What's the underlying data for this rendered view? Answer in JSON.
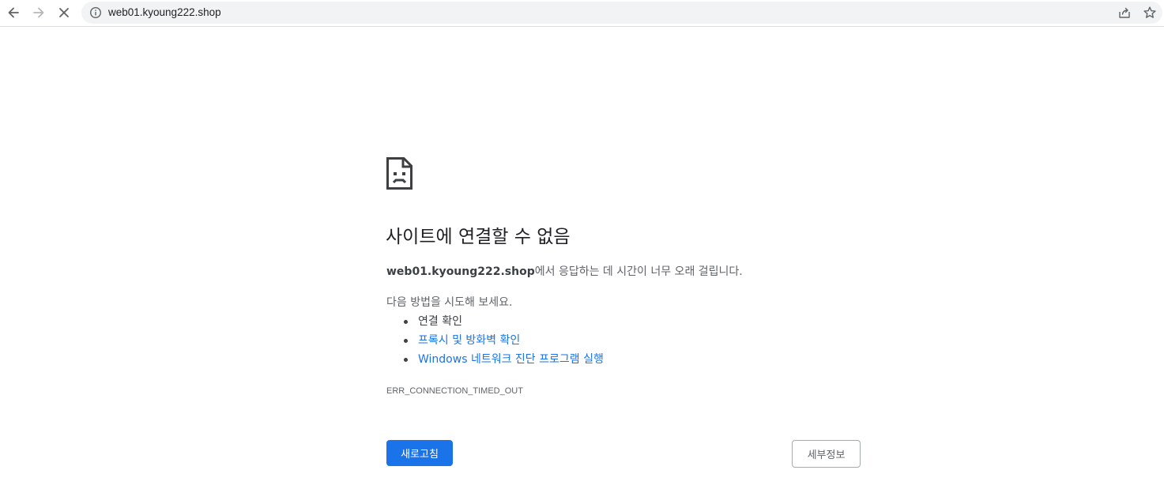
{
  "browser": {
    "url": "web01.kyoung222.shop",
    "icons": {
      "back": "arrow-left-icon",
      "forward": "arrow-right-icon",
      "stop": "close-icon",
      "site_info": "info-icon",
      "share": "share-icon",
      "bookmark": "star-icon"
    }
  },
  "error_page": {
    "icon": "sad-page-icon",
    "heading": "사이트에 연결할 수 없음",
    "summary_host": "web01.kyoung222.shop",
    "summary_text": "에서 응답하는 데 시간이 너무 오래 걸립니다.",
    "suggestions_intro": "다음 방법을 시도해 보세요.",
    "suggestions": [
      {
        "label": "연결 확인",
        "link": false
      },
      {
        "label": "프록시 및 방화벽 확인",
        "link": true
      },
      {
        "label": "Windows 네트워크 진단 프로그램 실행",
        "link": true
      }
    ],
    "error_code": "ERR_CONNECTION_TIMED_OUT",
    "reload_label": "새로고침",
    "details_label": "세부정보"
  },
  "colors": {
    "accent": "#1a73e8",
    "text_primary": "#202124",
    "text_secondary": "#5f6368"
  }
}
